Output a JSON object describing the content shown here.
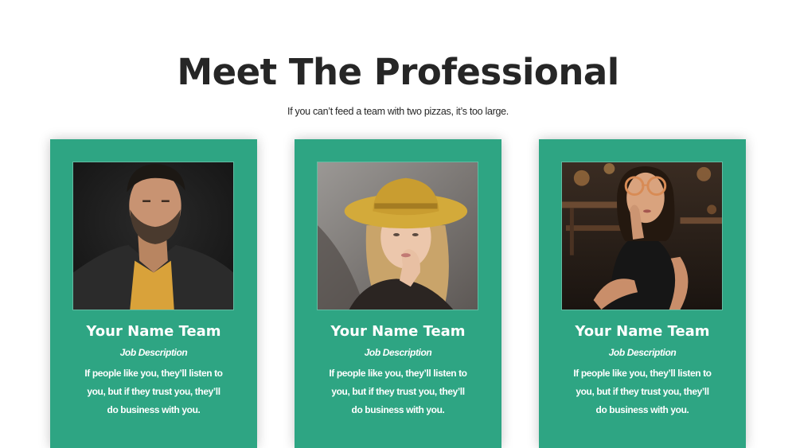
{
  "heading": {
    "title": "Meet The Professional",
    "subtitle": "If you can’t feed a team with two pizzas, it’s too large."
  },
  "colors": {
    "card_background": "#2ea583",
    "title_text": "#262626",
    "card_text": "#ffffff"
  },
  "team": [
    {
      "name": "Your Name Team",
      "job": "Job Description",
      "description": "If people like you, they’ll listen to you, but if they trust you, they’ll do business with you."
    },
    {
      "name": "Your Name Team",
      "job": "Job Description",
      "description": "If people like you, they’ll listen to you, but if they trust you, they’ll do business with you."
    },
    {
      "name": "Your Name Team",
      "job": "Job Description",
      "description": "If people like you, they’ll listen to you, but if they trust you, they’ll do business with you."
    }
  ]
}
